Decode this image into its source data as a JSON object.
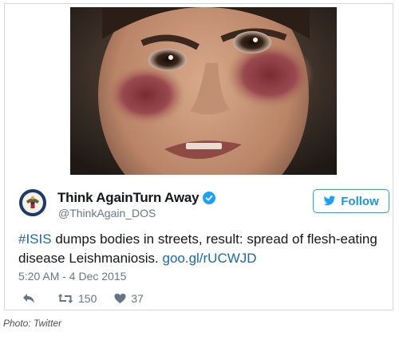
{
  "tweet": {
    "display_name": "Think AgainTurn Away",
    "handle": "@ThinkAgain_DOS",
    "text_hashtag": "#ISIS",
    "text_body": " dumps bodies in streets, result: spread of flesh-eating disease Leishmaniosis. ",
    "text_link": "goo.gl/rUCWJD",
    "timestamp": "5:20 AM - 4 Dec 2015",
    "retweets": "150",
    "likes": "37",
    "verified": true
  },
  "follow_button": {
    "label": "Follow"
  },
  "credit": "Photo: Twitter",
  "icons": {
    "avatar": "state-department-seal-icon",
    "verified": "verified-badge-icon",
    "follow": "twitter-bird-icon",
    "reply": "reply-icon",
    "retweet": "retweet-icon",
    "like": "heart-icon"
  },
  "colors": {
    "accent": "#1da1f2",
    "link": "#1b6aa5",
    "text": "#14171a",
    "muted": "#657786"
  }
}
